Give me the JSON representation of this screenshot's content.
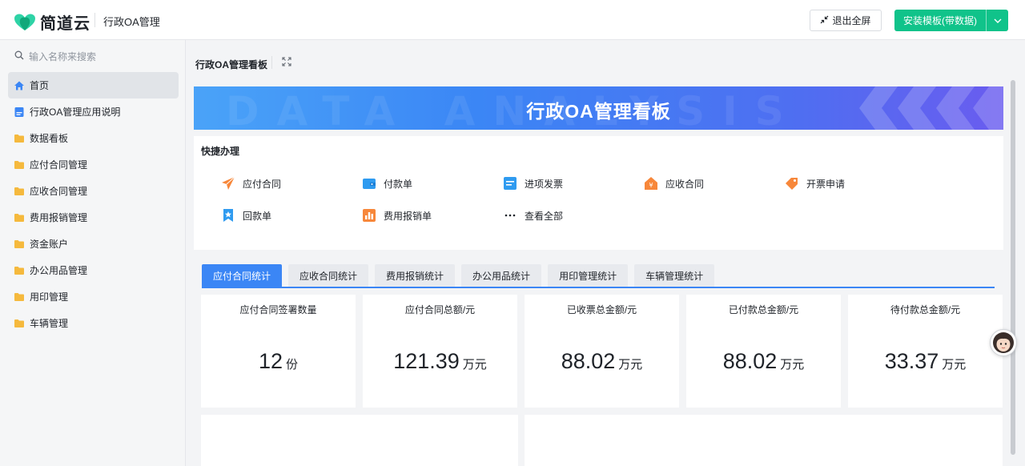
{
  "header": {
    "logo_text": "简道云",
    "app_name": "行政OA管理",
    "exit_fullscreen_label": "退出全屏",
    "install_label": "安装模板(带数据)"
  },
  "sidebar": {
    "search_placeholder": "输入名称来搜索",
    "items": [
      {
        "label": "首页",
        "icon": "home-icon",
        "active": true
      },
      {
        "label": "行政OA管理应用说明",
        "icon": "document-icon"
      },
      {
        "label": "数据看板",
        "icon": "folder-icon"
      },
      {
        "label": "应付合同管理",
        "icon": "folder-icon"
      },
      {
        "label": "应收合同管理",
        "icon": "folder-icon"
      },
      {
        "label": "费用报销管理",
        "icon": "folder-icon"
      },
      {
        "label": "资金账户",
        "icon": "folder-icon"
      },
      {
        "label": "办公用品管理",
        "icon": "folder-icon"
      },
      {
        "label": "用印管理",
        "icon": "folder-icon"
      },
      {
        "label": "车辆管理",
        "icon": "folder-icon"
      }
    ]
  },
  "main": {
    "page_title": "行政OA管理看板",
    "banner_title": "行政OA管理看板",
    "banner_watermark": "DATA ANALYSIS",
    "quick": {
      "title": "快捷办理",
      "items": [
        {
          "label": "应付合同",
          "icon": "paper-plane-icon"
        },
        {
          "label": "付款单",
          "icon": "wallet-icon"
        },
        {
          "label": "进项发票",
          "icon": "invoice-icon"
        },
        {
          "label": "应收合同",
          "icon": "yuan-house-icon"
        },
        {
          "label": "开票申请",
          "icon": "tag-icon"
        },
        {
          "label": "回款单",
          "icon": "bookmark-star-icon"
        },
        {
          "label": "费用报销单",
          "icon": "bar-chart-icon"
        },
        {
          "label": "查看全部",
          "icon": "more-dots-icon"
        }
      ]
    },
    "tabs": [
      {
        "label": "应付合同统计",
        "active": true
      },
      {
        "label": "应收合同统计"
      },
      {
        "label": "费用报销统计"
      },
      {
        "label": "办公用品统计"
      },
      {
        "label": "用印管理统计"
      },
      {
        "label": "车辆管理统计"
      }
    ],
    "stats": [
      {
        "label": "应付合同签署数量",
        "value": "12",
        "unit": "份"
      },
      {
        "label": "应付合同总额/元",
        "value": "121.39",
        "unit": "万元"
      },
      {
        "label": "已收票总金额/元",
        "value": "88.02",
        "unit": "万元"
      },
      {
        "label": "已付款总金额/元",
        "value": "88.02",
        "unit": "万元"
      },
      {
        "label": "待付款总金额/元",
        "value": "33.37",
        "unit": "万元"
      }
    ]
  },
  "colors": {
    "brand_green": "#10c38a",
    "accent_blue": "#3b86f5",
    "folder_yellow": "#f5b93d",
    "quick_orange": "#f7873a"
  }
}
